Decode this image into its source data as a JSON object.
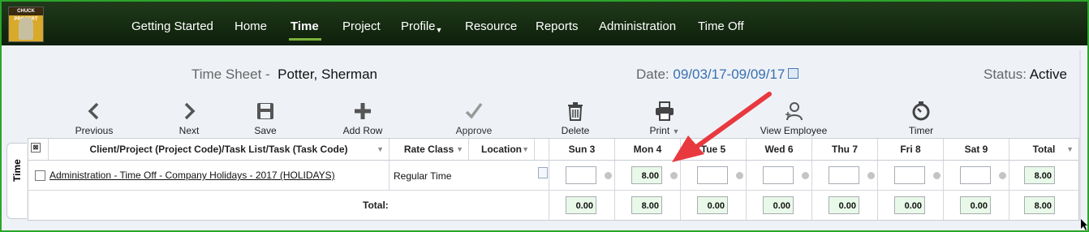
{
  "nav": {
    "items": [
      {
        "label": "Getting Started"
      },
      {
        "label": "Home"
      },
      {
        "label": "Time"
      },
      {
        "label": "Project"
      },
      {
        "label": "Profile"
      },
      {
        "label": "Resource"
      },
      {
        "label": "Reports"
      },
      {
        "label": "Administration"
      },
      {
        "label": "Time Off"
      }
    ],
    "active": "Time",
    "logo_text": "CHUCK PROPERT",
    "accent": "#7ab23c"
  },
  "header": {
    "title_label": "Time Sheet -",
    "employee": "Potter, Sherman",
    "date_label": "Date:",
    "date_range": "09/03/17-09/09/17",
    "status_label": "Status:",
    "status_value": "Active"
  },
  "toolbar": {
    "previous": "Previous",
    "next": "Next",
    "save": "Save",
    "add_row": "Add Row",
    "approve": "Approve",
    "delete": "Delete",
    "print": "Print",
    "view_employee": "View Employee",
    "timer": "Timer"
  },
  "side_tab": "Time",
  "grid": {
    "headers": {
      "task": "Client/Project (Project Code)/Task List/Task (Task Code)",
      "rate": "Rate Class",
      "location": "Location",
      "days": [
        "Sun 3",
        "Mon 4",
        "Tue 5",
        "Wed 6",
        "Thu 7",
        "Fri 8",
        "Sat 9"
      ],
      "total": "Total"
    },
    "row": {
      "task": "Administration - Time Off - Company Holidays - 2017 (HOLIDAYS)",
      "rate_class": "Regular Time",
      "hours": [
        "",
        "8.00",
        "",
        "",
        "",
        "",
        ""
      ],
      "total": "8.00"
    },
    "totals": {
      "label": "Total:",
      "days": [
        "0.00",
        "8.00",
        "0.00",
        "0.00",
        "0.00",
        "0.00",
        "0.00"
      ],
      "total": "8.00"
    }
  },
  "colors": {
    "nav_bg": "#1f3a1a",
    "frame_border": "#2aa52a",
    "annotation_arrow": "#e8393f",
    "cell_filled": "#e9f9e9"
  }
}
